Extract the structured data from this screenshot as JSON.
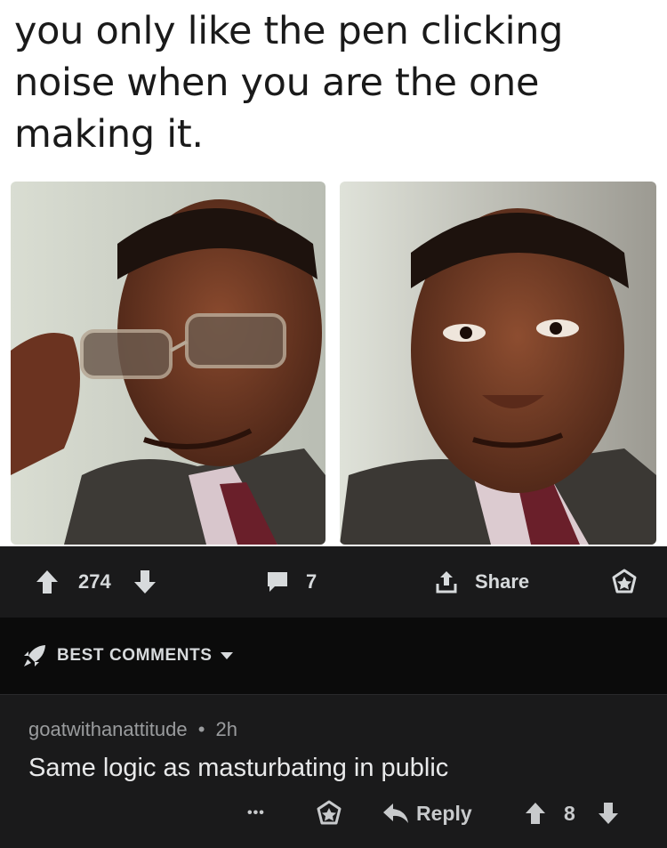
{
  "meme": {
    "caption": "you only like the pen clicking noise when you are the one making it."
  },
  "post_actions": {
    "upvote_count": "274",
    "comment_count": "7",
    "share_label": "Share"
  },
  "sort": {
    "label": "BEST COMMENTS"
  },
  "comment": {
    "author": "goatwithanattitude",
    "separator": "•",
    "time": "2h",
    "body": "Same logic as masturbating in public",
    "more_label": "•••",
    "reply_label": "Reply",
    "score": "8"
  },
  "icons": {
    "upvote": "arrow-up-icon",
    "downvote": "arrow-down-icon",
    "comment": "comment-bubble-icon",
    "share": "share-icon",
    "award": "award-icon",
    "rocket": "rocket-icon",
    "caret": "caret-down-icon",
    "reply": "reply-arrow-icon"
  },
  "colors": {
    "meme_bg": "#ffffff",
    "action_bar_bg": "#1a1a1b",
    "sort_bar_bg": "#0b0b0b",
    "comment_bg": "#1a1a1b",
    "text_primary": "#d7dadc",
    "text_muted": "#9a9c9e"
  }
}
